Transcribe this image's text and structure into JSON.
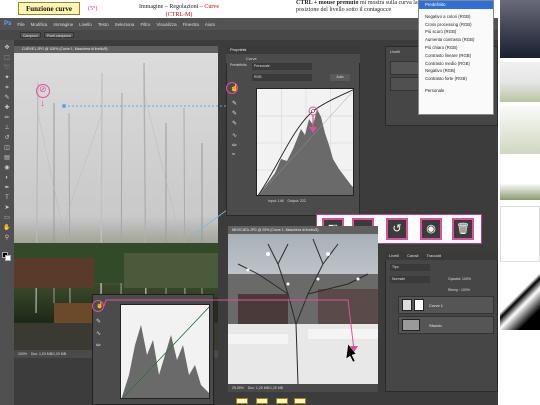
{
  "header": {
    "title": "Funzione curve",
    "step": "(5°)",
    "menu_path": "Immagine – Regolazioni – ",
    "menu_target": "Curve",
    "shortcut": "(CTRL-M)",
    "ctrl_note_bold": "CTRL + mouse premuto",
    "ctrl_note_text": " mi mostra sulla curva la posizione del livello sotto il contagocce"
  },
  "photoshop": {
    "menu": [
      "File",
      "Modifica",
      "Immagine",
      "Livello",
      "Testo",
      "Seleziona",
      "Filtro",
      "Visualizza",
      "Finestra",
      "Aiuto"
    ],
    "options": [
      "Campioni",
      "Punti campione"
    ],
    "doc1_title": "CURVE1.JPG @ 100% (Curve 1, Maschera di livello/8)",
    "doc1_status": "Doc: 1,03 MB/1,03 MB",
    "doc1_zoom": "100%",
    "doc2_title": "NEVICATA.JPG @ 25% (Curve 1, Maschera di livello/8)",
    "doc2_status": "Doc: 1,25 MB/1,25 MB",
    "doc2_zoom": "25,05%",
    "props_title": "Proprietà",
    "props_adj": "Curve",
    "preset_label": "Predefinito",
    "preset_value": "Personale",
    "channel": "RGB",
    "auto_btn": "Auto",
    "input_label": "Input:",
    "input_value": "146",
    "output_label": "Output:",
    "output_value": "222",
    "layers_title": "Livelli",
    "layers_tabs": [
      "Livelli",
      "Canali",
      "Tracciati"
    ],
    "blend_mode": "Normale",
    "opacity_label": "Opacità:",
    "opacity_value": "100%",
    "fill_label": "Riemp.:",
    "fill_value": "100%",
    "layer_adj_name": "Curve 1",
    "layer_bg_name": "Sfondo",
    "kind_label": "Tipo"
  },
  "preset_menu": {
    "items": [
      {
        "label": "Predefinito",
        "selected": true
      },
      {
        "label": "Negativo a colori (RGB)"
      },
      {
        "label": "Cross processing (RGB)"
      },
      {
        "label": "Più scuro (RGB)"
      },
      {
        "label": "Aumenta contrasto (RGB)"
      },
      {
        "label": "Più chiaro (RGB)"
      },
      {
        "label": "Contrasto lineare (RGB)"
      },
      {
        "label": "Contrasto medio (RGB)"
      },
      {
        "label": "Negativo (RGB)"
      },
      {
        "label": "Contrasto forte (RGB)"
      },
      {
        "label": "Personale"
      }
    ]
  },
  "icon_strip": [
    "clip-to-layer-icon",
    "view-previous-icon",
    "reset-icon",
    "visibility-icon",
    "trash-icon"
  ],
  "colors": {
    "accent": "#e0509a",
    "ps_bg": "#3c3c3c",
    "note_yellow": "#fff6b0",
    "menu_selected": "#2f6fd8"
  }
}
